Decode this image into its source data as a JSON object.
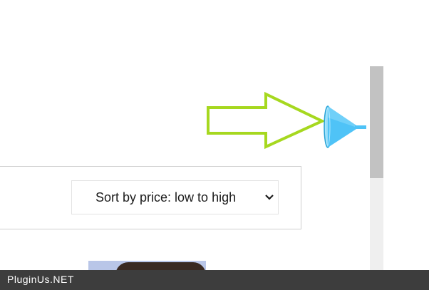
{
  "toolbar": {
    "sort_select": {
      "selected_value": "Sort by price: low to high"
    }
  },
  "icons": {
    "filter": "funnel-icon",
    "pointer": "arrow-outline"
  },
  "footer": {
    "brand": "PluginUs.NET"
  },
  "colors": {
    "arrow_outline": "#a6d81f",
    "funnel": "#4fc3f7",
    "footer_bg": "#3d3d3d",
    "scrollbar_thumb": "#c2c2c2",
    "scrollbar_track": "#efefef"
  }
}
